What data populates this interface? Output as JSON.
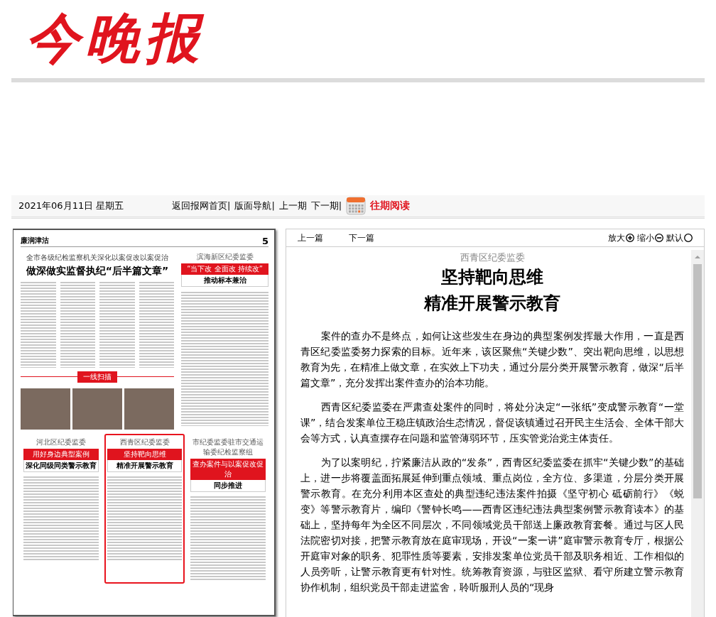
{
  "masthead": {
    "logo": "今晚报"
  },
  "nav_bar": {
    "date": "2021年06月11日 星期五",
    "links": [
      {
        "label": "返回报网首页|"
      },
      {
        "label": "版面导航|"
      },
      {
        "label": "上一期"
      },
      {
        "label": "下一期|"
      }
    ],
    "archive": "往期阅读"
  },
  "page_scan": {
    "section": "廉润津沽",
    "page_number": "5",
    "kicker": "全市各级纪检监察机关深化以案促改以案促治",
    "headline": "做深做实监督执纪“后半篇文章”",
    "side_story": {
      "source": "滨海新区纪委监委",
      "title": "“当下改 全面改 持续改”",
      "subtitle": "推动标本兼治"
    },
    "photo_banner": "一线扫描",
    "articles": [
      {
        "source": "河北区纪委监委",
        "title": "用好身边典型案例",
        "subtitle": "深化同级同类警示教育",
        "selected": false
      },
      {
        "source": "西青区纪委监委",
        "title": "坚持靶向思维",
        "subtitle": "精准开展警示教育",
        "selected": true
      },
      {
        "source": "市纪委监委驻市交通运输委纪检监察组",
        "title": "查办案件与以案促改促治",
        "subtitle": "同步推进",
        "selected": false
      }
    ]
  },
  "article_toolbar": {
    "prev": "上一篇",
    "next": "下一篇",
    "zoom": [
      {
        "label": "放大",
        "kind": "plus"
      },
      {
        "label": "缩小",
        "kind": "minus"
      },
      {
        "label": "默认",
        "kind": "reset"
      }
    ]
  },
  "article": {
    "source": "西青区纪委监委",
    "title_lines": [
      "坚持靶向思维",
      "精准开展警示教育"
    ],
    "paragraphs": [
      "案件的查办不是终点，如何让这些发生在身边的典型案例发挥最大作用，一直是西青区纪委监委努力探索的目标。近年来，该区聚焦“关键少数”、突出靶向思维，以思想教育为先，在精准上做文章，在实效上下功夫，通过分层分类开展警示教育，做深“后半篇文章”，充分发挥出案件查办的治本功能。",
      "西青区纪委监委在严肃查处案件的同时，将处分决定“一张纸”变成警示教育“一堂课”，结合发案单位王稳庄镇政治生态情况，督促该镇通过召开民主生活会、全体干部大会等方式，认真查摆存在问题和监管薄弱环节，压实管党治党主体责任。",
      "为了以案明纪，拧紧廉洁从政的“发条”，西青区纪委监委在抓牢“关键少数”的基础上，进一步将覆盖面拓展延伸到重点领域、重点岗位，全方位、多渠道，分层分类开展警示教育。在充分利用本区查处的典型违纪违法案件拍摄《坚守初心 砥砺前行》《蜕变》等警示教育片，编印《警钟长鸣——西青区违纪违法典型案例警示教育读本》的基础上，坚持每年为全区不同层次，不同领域党员干部送上廉政教育套餐。通过与区人民法院密切对接，把警示教育放在庭审现场，开设“一案一讲”庭审警示教育专厅，根据公开庭审对象的职务、犯罪性质等要素，安排发案单位党员干部及职务相近、工作相似的人员旁听，让警示教育更有针对性。统筹教育资源，与驻区监狱、看守所建立警示教育协作机制，组织党员干部走进监舍，聆听服刑人员的“现身"
    ]
  }
}
